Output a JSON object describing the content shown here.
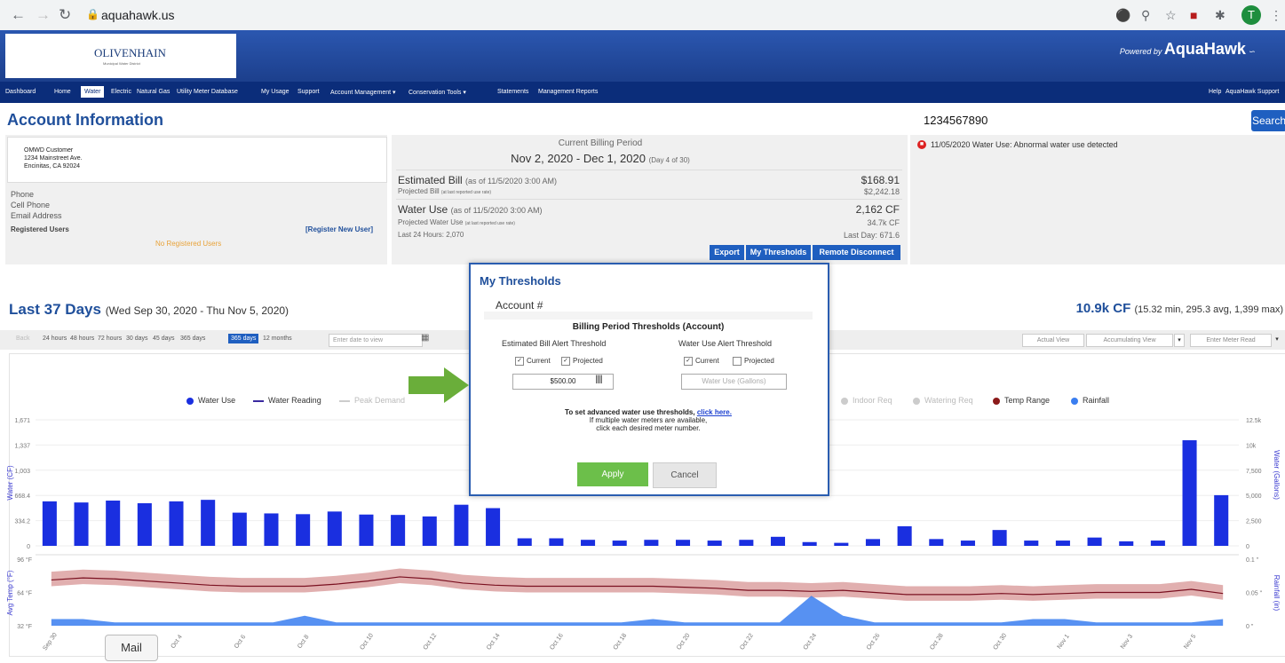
{
  "browser": {
    "url": "aquahawk.us",
    "profile_initial": "T"
  },
  "header": {
    "logo_text": "OLIVENHAIN",
    "logo_subtext": "Municipal Water District",
    "powered_by": "Powered by",
    "brand": "AquaHawk"
  },
  "menu": {
    "items": [
      "Dashboard",
      "Home",
      "Water",
      "Electric",
      "Natural Gas",
      "Utility Meter Database",
      "My Usage",
      "Support",
      "Account Management  ▾",
      "Conservation Tools  ▾",
      "Statements",
      "Management Reports"
    ],
    "active": "Water",
    "right_items": [
      "Help",
      "AquaHawk Support"
    ]
  },
  "account": {
    "title": "Account Information",
    "account_number": "1234567890",
    "search_label": "Search",
    "customer_name": "OMWD Customer",
    "address_line1": "1234 Mainstreet Ave.",
    "address_line2": "Encinitas, CA 92024",
    "phone_label": "Phone",
    "cell_label": "Cell Phone",
    "email_label": "Email Address",
    "registered_users_label": "Registered Users",
    "register_link": "[Register New User]",
    "no_users": "No Registered Users"
  },
  "billing": {
    "period_label": "Current Billing Period",
    "period_range": "Nov 2, 2020 - Dec 1, 2020",
    "period_day": "(Day 4 of 30)",
    "est_bill_label": "Estimated Bill",
    "est_bill_asof": "(as of 11/5/2020 3:00 AM)",
    "est_bill_value": "$168.91",
    "proj_bill_label": "Projected Bill",
    "proj_bill_note": "(at last reported use rate)",
    "proj_bill_value": "$2,242.18",
    "water_use_label": "Water Use",
    "water_use_asof": "(as of 11/5/2020 3:00 AM)",
    "water_use_value": "2,162 CF",
    "proj_water_label": "Projected Water Use",
    "proj_water_note": "(at last reported use rate)",
    "proj_water_value": "34.7k CF",
    "last24": "Last 24 Hours: 2,070",
    "last_day": "Last Day: 671.6",
    "buttons": [
      "Export",
      "My Thresholds",
      "Remote Disconnect"
    ]
  },
  "alert": {
    "icon": "alert-icon",
    "text": "11/05/2020  Water Use: Abnormal water use detected"
  },
  "usage": {
    "title": "Last 37 Days",
    "range": "(Wed Sep 30, 2020 - Thu Nov 5, 2020)",
    "total": "10.9k CF",
    "stats": "(15.32 min, 295.3 avg, 1,399 max)",
    "toolbar": [
      "Back",
      "24 hours",
      "48 hours",
      "72 hours",
      "30 days",
      "45 days",
      "365 days",
      "12 months"
    ],
    "toolbar_selected": "365 days",
    "date_placeholder": "Enter date to view",
    "right_toolbar": [
      "Actual View",
      "Accumulating View",
      "Enter Meter Read"
    ]
  },
  "legend": [
    {
      "label": "Water Use",
      "color": "#1a2fe0",
      "dim": false
    },
    {
      "label": "Water Reading",
      "color": "#3a2aa0",
      "dim": false
    },
    {
      "label": "Peak Demand",
      "color": "#cccccc",
      "dim": true
    },
    {
      "label": "Indoor Req",
      "color": "#cccccc",
      "dim": true
    },
    {
      "label": "Watering Req",
      "color": "#cccccc",
      "dim": true
    },
    {
      "label": "Temp Range",
      "color": "#8b1a1a",
      "dim": false
    },
    {
      "label": "Rainfall",
      "color": "#3a7ef0",
      "dim": false
    }
  ],
  "chart_data": {
    "type": "bar",
    "title": "",
    "ylabel": "Water (CF)",
    "y2label": "Water (Gallons)",
    "yticks": [
      "0",
      "334.2",
      "668.4",
      "1,003",
      "1,337",
      "1,671"
    ],
    "y2ticks": [
      "0",
      "2,500",
      "5,000",
      "7,500",
      "10k",
      "12.5k"
    ],
    "ylim": [
      0,
      1671
    ],
    "values": [
      590,
      575,
      600,
      565,
      590,
      610,
      440,
      430,
      420,
      455,
      415,
      410,
      390,
      545,
      500,
      100,
      100,
      80,
      70,
      80,
      80,
      70,
      80,
      120,
      50,
      40,
      90,
      260,
      90,
      70,
      210,
      70,
      70,
      110,
      60,
      70,
      1400,
      672
    ],
    "xticks": [
      "Sep 30",
      "Oct 2",
      "Oct 4",
      "Oct 6",
      "Oct 8",
      "Oct 10",
      "Oct 12",
      "Oct 14",
      "Oct 16",
      "Oct 18",
      "Oct 20",
      "Oct 22",
      "Oct 24",
      "Oct 26",
      "Oct 28",
      "Oct 30",
      "Nov 1",
      "Nov 3",
      "Nov 5"
    ],
    "temp_label": "Avg Temp (°F)",
    "temp_ticks": [
      "32 °F",
      "64 °F",
      "96 °F"
    ],
    "rain_label": "Rainfall (in)",
    "rain_ticks": [
      "0 \"",
      "0.05 \"",
      "0.1 \""
    ],
    "temp_avg": [
      76,
      78,
      77,
      75,
      73,
      71,
      70,
      70,
      70,
      72,
      75,
      79,
      77,
      73,
      71,
      70,
      70,
      70,
      70,
      70,
      69,
      68,
      66,
      66,
      65,
      66,
      64,
      62,
      62,
      62,
      63,
      62,
      63,
      64,
      64,
      64,
      67,
      63
    ],
    "rainfall": [
      0.01,
      0.01,
      0.005,
      0.005,
      0.005,
      0.005,
      0.005,
      0.005,
      0.015,
      0.005,
      0.005,
      0.005,
      0.005,
      0.005,
      0.005,
      0.005,
      0.005,
      0.005,
      0.005,
      0.01,
      0.005,
      0.005,
      0.005,
      0.005,
      0.045,
      0.015,
      0.005,
      0.005,
      0.005,
      0.005,
      0.005,
      0.01,
      0.01,
      0.005,
      0.005,
      0.005,
      0.005,
      0.01
    ]
  },
  "modal": {
    "title": "My Thresholds",
    "account_label": "Account #",
    "section_title": "Billing Period Thresholds (Account)",
    "bill_col_title": "Estimated Bill Alert Threshold",
    "water_col_title": "Water Use Alert Threshold",
    "current_label": "Current",
    "projected_label": "Projected",
    "bill_value": "$500.00",
    "water_placeholder": "Water Use (Gallons)",
    "adv_text": "To set advanced water use thresholds,",
    "adv_link": "click here.",
    "multi_text1": "If multiple water meters are available,",
    "multi_text2": "click each desired meter number.",
    "apply": "Apply",
    "cancel": "Cancel"
  },
  "taskbar": {
    "mail": "Mail"
  }
}
